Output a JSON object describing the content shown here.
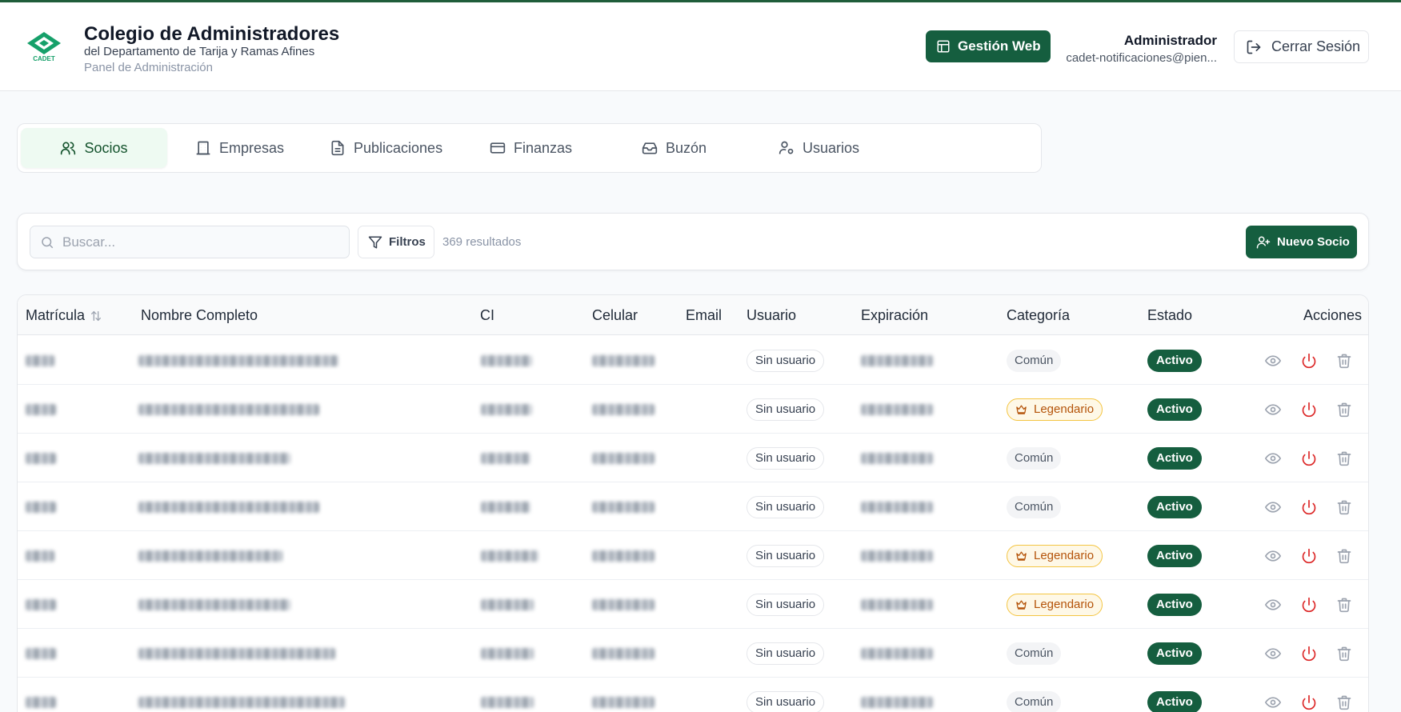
{
  "header": {
    "title": "Colegio de Administradores",
    "subtitle": "del Departamento de Tarija y Ramas Afines",
    "panel": "Panel de Administración",
    "logo_text": "CADET",
    "gestion_label": "Gestión Web",
    "user_name": "Administrador",
    "user_email": "cadet-notificaciones@pien...",
    "logout_label": "Cerrar Sesión"
  },
  "tabs": [
    {
      "label": "Socios",
      "icon": "users-icon",
      "active": true
    },
    {
      "label": "Empresas",
      "icon": "building-icon",
      "active": false
    },
    {
      "label": "Publicaciones",
      "icon": "document-icon",
      "active": false
    },
    {
      "label": "Finanzas",
      "icon": "credit-card-icon",
      "active": false
    },
    {
      "label": "Buzón",
      "icon": "inbox-icon",
      "active": false
    },
    {
      "label": "Usuarios",
      "icon": "user-cog-icon",
      "active": false
    }
  ],
  "toolbar": {
    "search_placeholder": "Buscar...",
    "filter_label": "Filtros",
    "results": "369 resultados",
    "new_label": "Nuevo Socio"
  },
  "table": {
    "columns": [
      "Matrícula",
      "Nombre Completo",
      "CI",
      "Celular",
      "Email",
      "Usuario",
      "Expiración",
      "Categoría",
      "Estado",
      "Acciones"
    ],
    "rows": [
      {
        "usuario": "Sin usuario",
        "categoria": "Común",
        "legendario": false,
        "estado": "Activo"
      },
      {
        "usuario": "Sin usuario",
        "categoria": "Legendario",
        "legendario": true,
        "estado": "Activo"
      },
      {
        "usuario": "Sin usuario",
        "categoria": "Común",
        "legendario": false,
        "estado": "Activo"
      },
      {
        "usuario": "Sin usuario",
        "categoria": "Común",
        "legendario": false,
        "estado": "Activo"
      },
      {
        "usuario": "Sin usuario",
        "categoria": "Legendario",
        "legendario": true,
        "estado": "Activo"
      },
      {
        "usuario": "Sin usuario",
        "categoria": "Legendario",
        "legendario": true,
        "estado": "Activo"
      },
      {
        "usuario": "Sin usuario",
        "categoria": "Común",
        "legendario": false,
        "estado": "Activo"
      },
      {
        "usuario": "Sin usuario",
        "categoria": "Común",
        "legendario": false,
        "estado": "Activo"
      }
    ]
  },
  "colors": {
    "brand": "#155e3f",
    "legendario_border": "#f4c542",
    "legendario_text": "#b45309",
    "power": "#dc2626"
  }
}
